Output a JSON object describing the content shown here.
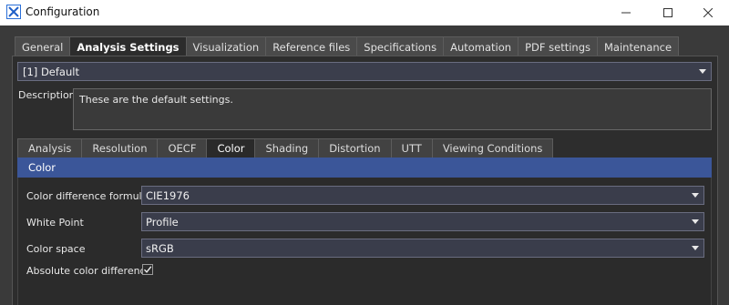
{
  "window": {
    "title": "Configuration",
    "icon": "x-logo-icon",
    "controls": [
      "minimize",
      "maximize",
      "close"
    ]
  },
  "main_tabs": [
    {
      "label": "General",
      "active": false
    },
    {
      "label": "Analysis Settings",
      "active": true
    },
    {
      "label": "Visualization",
      "active": false
    },
    {
      "label": "Reference files",
      "active": false
    },
    {
      "label": "Specifications",
      "active": false
    },
    {
      "label": "Automation",
      "active": false
    },
    {
      "label": "PDF settings",
      "active": false
    },
    {
      "label": "Maintenance",
      "active": false
    }
  ],
  "profile": {
    "selected": "[1] Default"
  },
  "description": {
    "label": "Description",
    "value": "These are the default settings."
  },
  "sub_tabs": [
    {
      "label": "Analysis",
      "active": false
    },
    {
      "label": "Resolution",
      "active": false
    },
    {
      "label": "OECF",
      "active": false
    },
    {
      "label": "Color",
      "active": true
    },
    {
      "label": "Shading",
      "active": false
    },
    {
      "label": "Distortion",
      "active": false
    },
    {
      "label": "UTT",
      "active": false
    },
    {
      "label": "Viewing Conditions",
      "active": false
    }
  ],
  "section": {
    "title": "Color"
  },
  "fields": {
    "color_difference_formula": {
      "label": "Color difference formula",
      "value": "CIE1976"
    },
    "white_point": {
      "label": "White Point",
      "value": "Profile"
    },
    "color_space": {
      "label": "Color space",
      "value": "sRGB"
    },
    "absolute_color_difference": {
      "label": "Absolute color difference",
      "checked": true
    }
  },
  "colors": {
    "section_header": "#3b5699",
    "background": "#3a3a3a",
    "panel": "#2d2d2d"
  }
}
